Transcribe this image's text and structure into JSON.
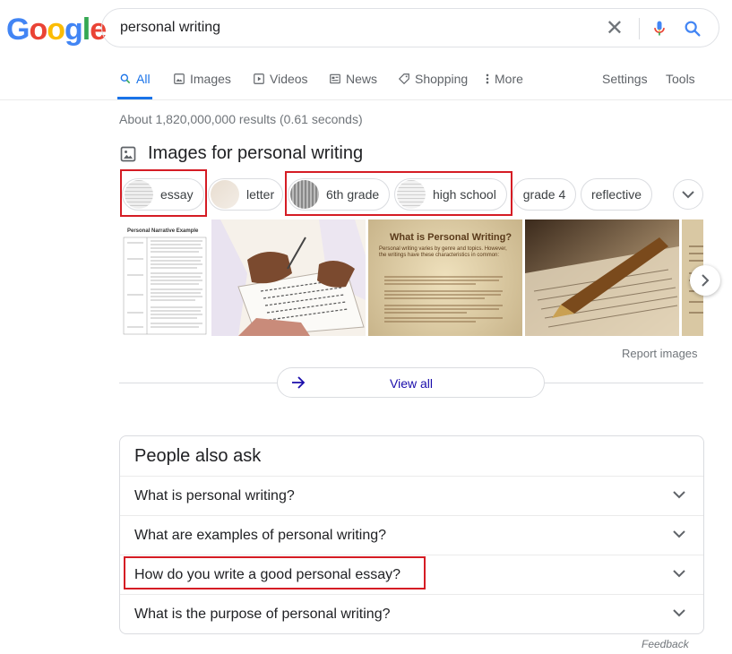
{
  "logo": {
    "letters": [
      "G",
      "o",
      "o",
      "g",
      "l",
      "e"
    ],
    "colors": [
      "#4285F4",
      "#EA4335",
      "#FBBC05",
      "#4285F4",
      "#34A853",
      "#EA4335"
    ]
  },
  "search": {
    "query": "personal writing",
    "clear_icon": "close-icon",
    "mic_icon": "mic-icon",
    "search_icon": "search-icon"
  },
  "tabs": [
    {
      "label": "All",
      "icon": "search-icon"
    },
    {
      "label": "Images",
      "icon": "image-icon"
    },
    {
      "label": "Videos",
      "icon": "play-icon"
    },
    {
      "label": "News",
      "icon": "news-icon"
    },
    {
      "label": "Shopping",
      "icon": "tag-icon"
    },
    {
      "label": "More",
      "icon": "more-vert-icon"
    },
    {
      "label": "Settings"
    },
    {
      "label": "Tools"
    }
  ],
  "stats": "About 1,820,000,000 results (0.61 seconds)",
  "images_section": {
    "title": "Images for personal writing",
    "chips": [
      "essay",
      "letter",
      "6th grade",
      "high school",
      "grade 4",
      "reflective"
    ],
    "report": "Report images",
    "view_all": "View all",
    "image_texts": {
      "img1_title": "Personal Narrative Example",
      "img3_title": "What is Personal Writing?",
      "img3_body": "Personal writing varies by genre and topics. However, the writings have these characteristics in common:"
    }
  },
  "paa": {
    "title": "People also ask",
    "questions": [
      "What is personal writing?",
      "What are examples of personal writing?",
      "How do you write a good personal essay?",
      "What is the purpose of personal writing?"
    ]
  },
  "feedback": "Feedback",
  "colors": {
    "accent": "#1a73e8",
    "highlight": "#d51c24",
    "link": "#1a0dab"
  }
}
